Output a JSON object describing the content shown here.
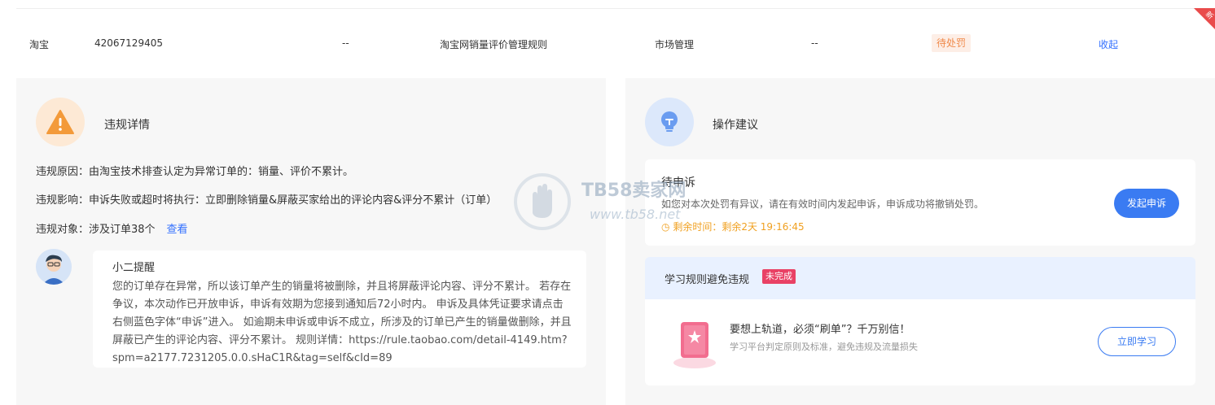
{
  "top_row": {
    "platform": "淘宝",
    "id": "42067129405",
    "col3": "--",
    "rule": "淘宝网销量评价管理规则",
    "category": "市场管理",
    "col6": "--",
    "status": "待处罚",
    "action": "收起",
    "new_tag": "新",
    "colors": {
      "status_bg": "#fdeee6",
      "status_text": "#f08a4b",
      "link": "#3370ff",
      "new_tag": "#e94b4b"
    }
  },
  "violation": {
    "title": "违规详情",
    "reason": "违规原因：由淘宝技术排查认定为异常订单的：销量、评价不累计。",
    "impact": "违规影响：申诉失败或超时将执行：立即删除销量&屏蔽买家给出的评论内容&评分不累计（订单）",
    "target": "违规对象：涉及订单38个",
    "view_link": "查看"
  },
  "reminder": {
    "title": "小二提醒",
    "text": "您的订单存在异常，所以该订单产生的销量将被删除，并且将屏蔽评论内容、评分不累计。 若存在争议，本次动作已开放申诉，申诉有效期为您接到通知后72小时内。 申诉及具体凭证要求请点击右侧蓝色字体“申诉”进入。 如逾期未申诉或申诉不成立，所涉及的订单已产生的销量做删除，并且屏蔽已产生的评论内容、评分不累计。 规则详情：https://rule.taobao.com/detail-4149.htm?spm=a2177.7231205.0.0.sHaC1R&tag=self&cId=89"
  },
  "advice": {
    "title": "操作建议",
    "appeal": {
      "title": "待申诉",
      "desc": "如您对本次处罚有异议，请在有效时间内发起申诉，申诉成功将撤销处罚。",
      "time_label": "剩余时间：剩余2天 19:16:45",
      "button": "发起申诉"
    },
    "learn": {
      "title": "学习规则避免违规",
      "badge": "未完成",
      "main": "要想上轨道，必须“刷单”？千万别信！",
      "sub": "学习平台判定原则及标准，避免违规及流量损失",
      "button": "立即学习"
    }
  },
  "watermark": {
    "title": "TB58卖家网",
    "url": "www.tb58.net"
  },
  "icons": {
    "warning": "warning-icon",
    "bulb": "bulb-icon",
    "clock": "clock-icon",
    "book": "book-icon",
    "avatar": "avatar"
  }
}
